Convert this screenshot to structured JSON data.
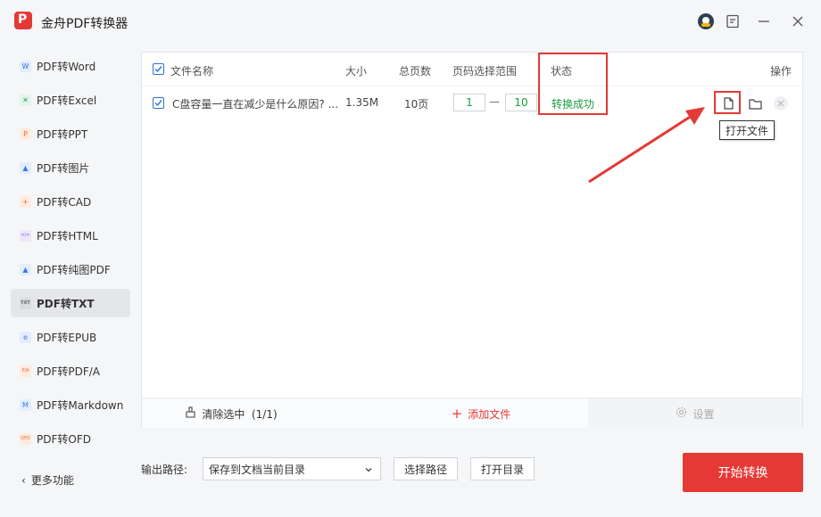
{
  "app": {
    "title": "金舟PDF转换器",
    "logo_letter": "P"
  },
  "sidebar": {
    "items": [
      {
        "label": "PDF转Word",
        "icon": "word-icon",
        "glyph": "W",
        "color": "#2b6fd6",
        "bg": "#e3edfb"
      },
      {
        "label": "PDF转Excel",
        "icon": "excel-icon",
        "glyph": "✕",
        "color": "#1a9c5c",
        "bg": "#e2f5ea"
      },
      {
        "label": "PDF转PPT",
        "icon": "ppt-icon",
        "glyph": "P",
        "color": "#e86a2c",
        "bg": "#fdebe0"
      },
      {
        "label": "PDF转图片",
        "icon": "image-icon",
        "glyph": "▲",
        "color": "#3b7be0",
        "bg": "#e3edfb"
      },
      {
        "label": "PDF转CAD",
        "icon": "cad-icon",
        "glyph": "+",
        "color": "#e86a2c",
        "bg": "#fdebe0"
      },
      {
        "label": "PDF转HTML",
        "icon": "html-icon",
        "glyph": "</>",
        "color": "#7a4fd6",
        "bg": "#eee6fb"
      },
      {
        "label": "PDF转纯图PDF",
        "icon": "pure-image-pdf-icon",
        "glyph": "▲",
        "color": "#3b7be0",
        "bg": "#e3edfb"
      },
      {
        "label": "PDF转TXT",
        "icon": "txt-icon",
        "glyph": "TXT",
        "color": "#666666",
        "bg": "#d8dbe0"
      },
      {
        "label": "PDF转EPUB",
        "icon": "epub-icon",
        "glyph": "e",
        "color": "#3b7be0",
        "bg": "#e3edfb"
      },
      {
        "label": "PDF转PDF/A",
        "icon": "pdfa-icon",
        "glyph": "P/A",
        "color": "#e86a2c",
        "bg": "#fdebe0"
      },
      {
        "label": "PDF转Markdown",
        "icon": "markdown-icon",
        "glyph": "M",
        "color": "#3b7be0",
        "bg": "#e3edfb"
      },
      {
        "label": "PDF转OFD",
        "icon": "ofd-icon",
        "glyph": "OFD",
        "color": "#e86a2c",
        "bg": "#fdebe0"
      }
    ],
    "active_index": 7,
    "more_label": "更多功能"
  },
  "table": {
    "headers": {
      "name": "文件名称",
      "size": "大小",
      "pages": "总页数",
      "range": "页码选择范围",
      "status": "状态",
      "actions": "操作"
    },
    "rows": [
      {
        "name": "C盘容量一直在减少是什么原因? ...",
        "size": "1.35M",
        "pages": "10页",
        "range_from": "1",
        "range_to": "10",
        "dash": "—",
        "status": "转换成功"
      }
    ]
  },
  "tooltip": {
    "open_file": "打开文件"
  },
  "bottom_bar": {
    "clear": "清除选中  (1/1)",
    "add": "添加文件",
    "settings": "设置"
  },
  "footer": {
    "output_label": "输出路径:",
    "output_select": "保存到文档当前目录",
    "choose_path": "选择路径",
    "open_dir": "打开目录",
    "start": "开始转换"
  },
  "colors": {
    "accent": "#e53935",
    "success": "#1a9c3c",
    "checkbox": "#2b72d8"
  }
}
